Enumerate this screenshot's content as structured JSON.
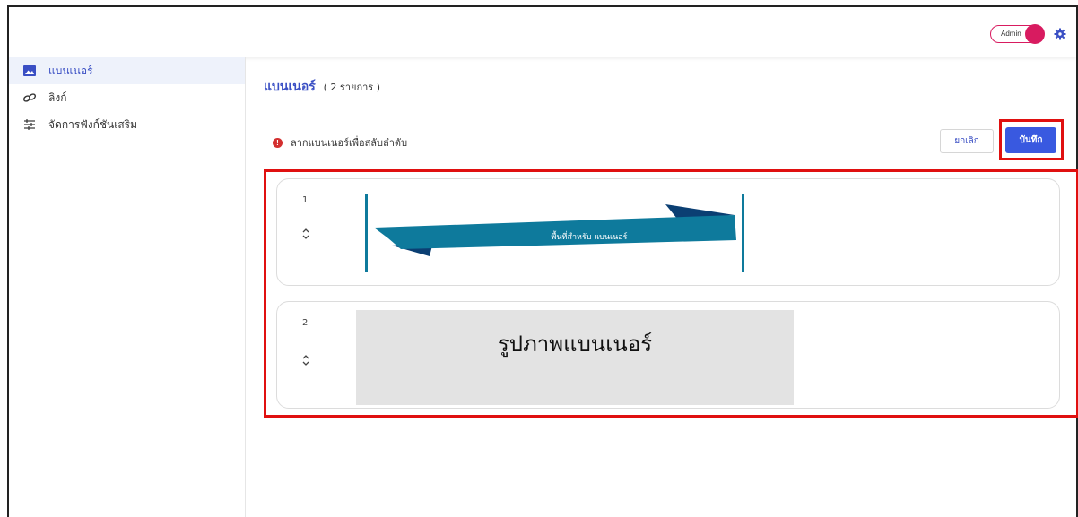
{
  "header": {
    "role_toggle_label": "Admin"
  },
  "sidebar": {
    "items": [
      {
        "label": "แบนเนอร์",
        "icon": "image-icon",
        "active": true
      },
      {
        "label": "ลิงก์",
        "icon": "link-icon",
        "active": false
      },
      {
        "label": "จัดการฟังก์ชันเสริม",
        "icon": "sliders-icon",
        "active": false
      }
    ]
  },
  "main": {
    "title": "แบนเนอร์",
    "count_text": "( 2 รายการ )",
    "hint_icon": "!",
    "hint": "ลากแบนเนอร์เพื่อสลับลำดับ",
    "cancel_label": "ยกเลิก",
    "save_label": "บันทึก",
    "banners": [
      {
        "order": "1",
        "image_text": "พื้นที่สำหรับ แบนเนอร์"
      },
      {
        "order": "2",
        "image_text": "รูปภาพแบนเนอร์"
      }
    ]
  },
  "colors": {
    "accent": "#3a4fc4",
    "primary_button": "#3959e0",
    "highlight": "#e01010",
    "toggle": "#d81b60",
    "ribbon": "#0e7a9c",
    "ribbon_dark": "#0b3f73"
  }
}
